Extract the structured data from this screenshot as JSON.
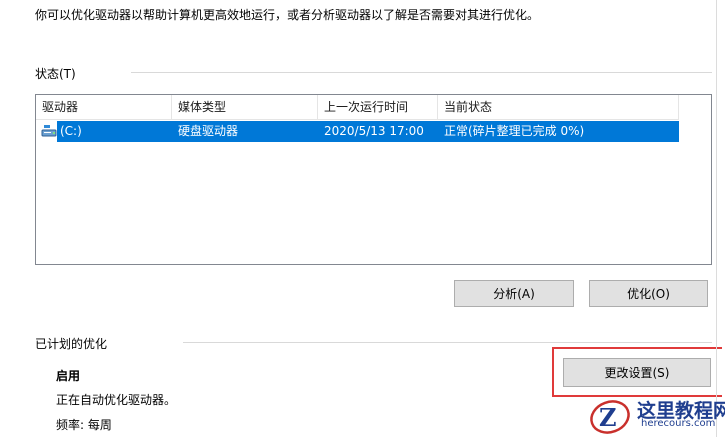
{
  "intro_text": "你可以优化驱动器以帮助计算机更高效地运行，或者分析驱动器以了解是否需要对其进行优化。",
  "status_section": {
    "label": "状态(T)",
    "columns": [
      "驱动器",
      "媒体类型",
      "上一次运行时间",
      "当前状态"
    ],
    "rows": [
      {
        "drive": "(C:)",
        "media_type": "硬盘驱动器",
        "last_run": "2020/5/13 17:00",
        "current_status": "正常(碎片整理已完成 0%)",
        "selected": true,
        "icon": "hard-drive-icon"
      }
    ]
  },
  "buttons": {
    "analyze": "分析(A)",
    "optimize": "优化(O)",
    "change_settings": "更改设置(S)"
  },
  "scheduled_section": {
    "label": "已计划的优化",
    "enabled": "启用",
    "status": "正在自动优化驱动器。",
    "frequency": "频率: 每周"
  },
  "watermark": {
    "name": "这里教程网",
    "url": "herecours.com"
  },
  "colors": {
    "selection": "#0078d7",
    "highlight_box": "#e03a3a",
    "watermark": "#1f3e8f"
  }
}
